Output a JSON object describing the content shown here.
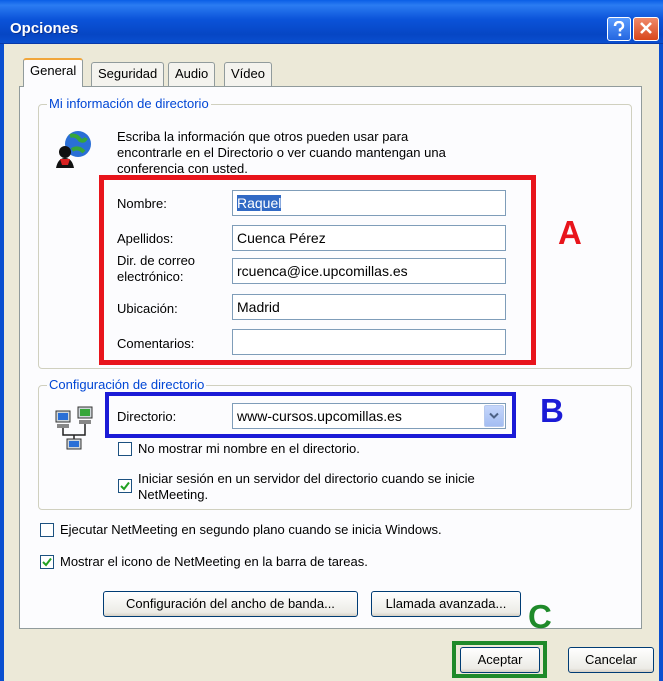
{
  "window": {
    "title": "Opciones"
  },
  "tabs": [
    {
      "label": "General",
      "active": true
    },
    {
      "label": "Seguridad"
    },
    {
      "label": "Audio"
    },
    {
      "label": "Vídeo"
    }
  ],
  "directory_info": {
    "legend": "Mi información de directorio",
    "intro_line1": "Escriba la información que otros pueden usar para",
    "intro_line2": "encontrarle en el Directorio o ver cuando mantengan una",
    "intro_line3": "conferencia con usted.",
    "fields": {
      "nombre": {
        "label": "Nombre:",
        "value": "Raquel"
      },
      "apellidos": {
        "label": "Apellidos:",
        "value": "Cuenca Pérez"
      },
      "email": {
        "label_line1": "Dir. de correo",
        "label_line2": "electrónico:",
        "value": "rcuenca@ice.upcomillas.es"
      },
      "ubicacion": {
        "label": "Ubicación:",
        "value": "Madrid"
      },
      "comentarios": {
        "label": "Comentarios:",
        "value": ""
      }
    }
  },
  "directory_config": {
    "legend": "Configuración de directorio",
    "directorio_label": "Directorio:",
    "directorio_value": "www-cursos.upcomillas.es",
    "hide_name": {
      "label": "No mostrar mi nombre en el directorio.",
      "checked": false
    },
    "login": {
      "label_line1": "Iniciar sesión en un servidor del directorio cuando se inicie",
      "label_line2": "NetMeeting.",
      "checked": true
    }
  },
  "options": {
    "background_run": {
      "label": "Ejecutar NetMeeting en segundo plano cuando se inicia Windows.",
      "checked": false
    },
    "taskbar_icon": {
      "label": "Mostrar el icono de NetMeeting en la barra de tareas.",
      "checked": true
    }
  },
  "buttons": {
    "bandwidth": "Configuración del ancho de banda...",
    "advanced_call": "Llamada avanzada...",
    "accept": "Aceptar",
    "cancel": "Cancelar"
  },
  "annotations": {
    "a": {
      "letter": "A",
      "color": "#e8141b"
    },
    "b": {
      "letter": "B",
      "color": "#1b1bd6"
    },
    "c": {
      "letter": "C",
      "color": "#1f8a2a"
    }
  },
  "colors": {
    "title_bar": "#0b53d9",
    "legend_text": "#0046d5",
    "selection": "#316ac5"
  },
  "icons": [
    "help-icon",
    "close-icon",
    "directory-globe-icon",
    "network-computers-icon",
    "chevron-down-icon",
    "checkmark-icon"
  ]
}
